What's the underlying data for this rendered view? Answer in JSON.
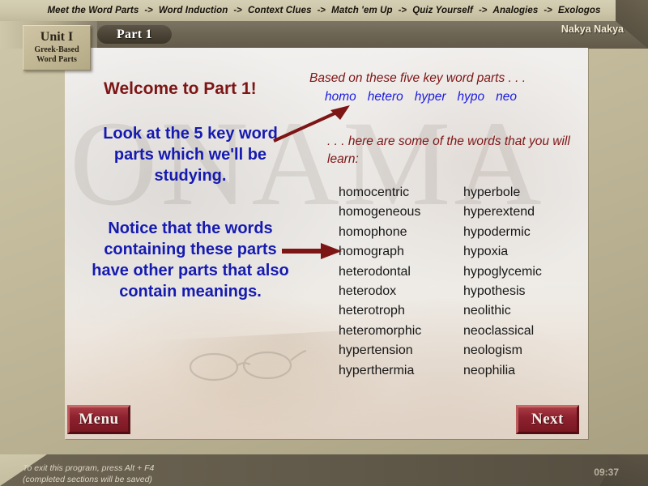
{
  "topnav": {
    "separator": "->",
    "items": [
      {
        "label": "Meet the Word Parts"
      },
      {
        "label": "Word Induction"
      },
      {
        "label": "Context Clues"
      },
      {
        "label": "Match 'em Up"
      },
      {
        "label": "Quiz Yourself"
      },
      {
        "label": "Analogies"
      },
      {
        "label": "Exologos"
      }
    ]
  },
  "header": {
    "unit_title": "Unit I",
    "unit_subtitle_line1": "Greek-Based",
    "unit_subtitle_line2": "Word Parts",
    "part_label": "Part 1",
    "username": "Nakya Nakya"
  },
  "main": {
    "welcome": "Welcome to Part 1!",
    "left_block_1": "Look at the 5 key word parts which we'll be studying.",
    "left_block_2": "Notice that the words containing these parts have other parts that also contain meanings.",
    "right_heading_1": "Based on these five key word parts . . .",
    "key_parts": [
      "homo",
      "hetero",
      "hyper",
      "hypo",
      "neo"
    ],
    "right_heading_2": ". . . here are some of the words that you will learn:",
    "word_list_column_1": [
      "homocentric",
      "homogeneous",
      "homophone",
      "homograph",
      "heterodontal",
      "heterodox",
      "heterotroph",
      "heteromorphic",
      "hypertension",
      "hyperthermia"
    ],
    "word_list_column_2": [
      "hyperbole",
      "hyperextend",
      "hypodermic",
      "hypoxia",
      "hypoglycemic",
      "hypothesis",
      "neolithic",
      "neoclassical",
      "neologism",
      "neophilia"
    ],
    "background_manuscript_text": "ONAMA"
  },
  "buttons": {
    "menu": "Menu",
    "next": "Next"
  },
  "statusbar": {
    "exit_line_1": "To exit this program, press Alt + F4",
    "exit_line_2": "(completed sections will be saved)",
    "clock": "09:37"
  },
  "colors": {
    "page_background": "#c3bb9c",
    "header_band": "#6e6655",
    "panel_background": "#ece9e4",
    "welcome_red": "#7d1515",
    "body_blue": "#151ab0",
    "key_part_blue": "#1a1ae0",
    "word_text": "#171717",
    "button_red": "#8e2230",
    "arrow_red": "#7d1515",
    "username_cream": "#f6ecd2",
    "clock_gray": "#b9b0a0"
  }
}
